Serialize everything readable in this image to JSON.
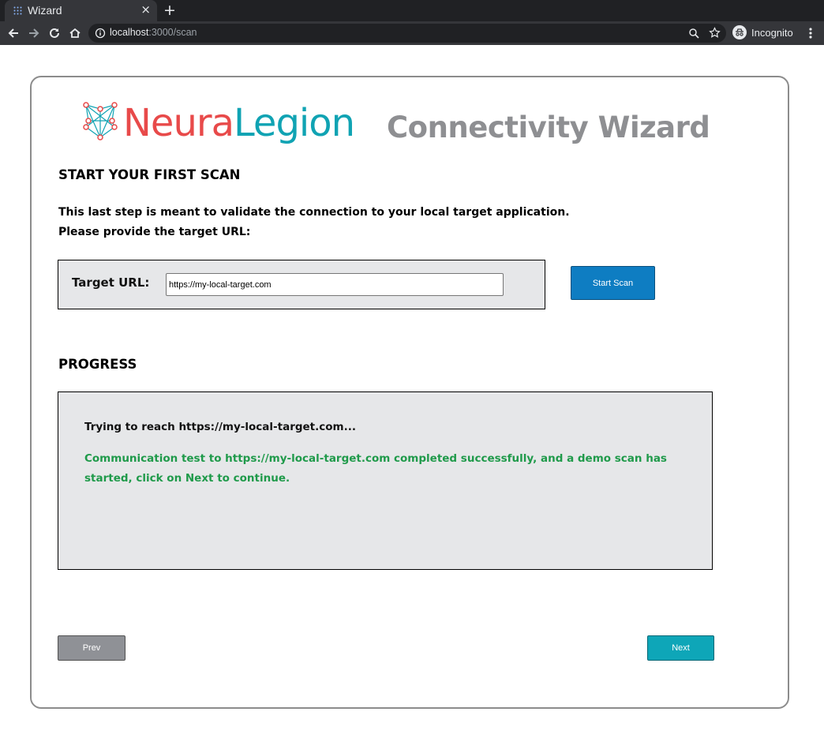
{
  "browser": {
    "tab_title": "Wizard",
    "tab_close": "×",
    "new_tab": "+",
    "url_host": "localhost",
    "url_path": ":3000/scan",
    "incognito_label": "Incognito"
  },
  "logo": {
    "part1": "Neura",
    "part2": "Legion",
    "colors": {
      "neura": "#e84a4a",
      "legion": "#10a3b3"
    }
  },
  "header": {
    "title": "Connectivity Wizard"
  },
  "scan_section": {
    "heading": "START YOUR FIRST SCAN",
    "description_line1": "This last step is meant to validate the connection to your local target application.",
    "description_line2": "Please provide the target URL:",
    "target_label": "Target URL:",
    "target_value": "https://my-local-target.com",
    "start_button": "Start Scan"
  },
  "progress_section": {
    "heading": "PROGRESS",
    "log": [
      {
        "status": "info",
        "text": "Trying to reach https://my-local-target.com..."
      },
      {
        "status": "success",
        "text": "Communication test to https://my-local-target.com completed successfully, and a demo scan has started, click on Next to continue."
      }
    ]
  },
  "footer": {
    "prev_button": "Prev",
    "next_button": "Next"
  },
  "colors": {
    "accent_blue": "#0e7dc2",
    "accent_teal": "#0ea6b8",
    "success_green": "#1f9a4a",
    "panel_gray": "#e6e7e9"
  }
}
